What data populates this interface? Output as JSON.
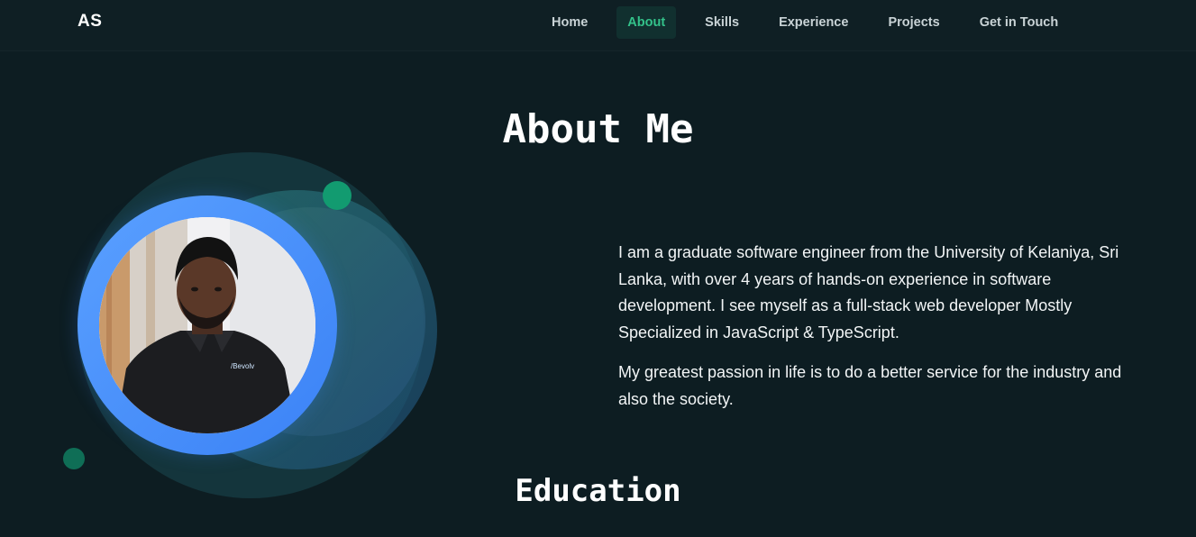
{
  "header": {
    "logo": "AS",
    "nav": [
      {
        "label": "Home",
        "active": false
      },
      {
        "label": "About",
        "active": true
      },
      {
        "label": "Skills",
        "active": false
      },
      {
        "label": "Experience",
        "active": false
      },
      {
        "label": "Projects",
        "active": false
      },
      {
        "label": "Get in Touch",
        "active": false
      }
    ]
  },
  "about": {
    "title": "About Me",
    "paragraphs": [
      "I am a graduate software engineer from the University of Kelaniya, Sri Lanka, with over 4 years of hands-on experience in software development. I see myself as a full-stack web developer Mostly Specialized in JavaScript & TypeScript.",
      "My greatest passion in life is to do a better service for the industry and also the society."
    ],
    "shirt_logo": "/Bevolv"
  },
  "education": {
    "title": "Education"
  },
  "colors": {
    "background": "#0d1d22",
    "accent_green": "#33c28a",
    "ring_blue": "#3b82f6"
  }
}
